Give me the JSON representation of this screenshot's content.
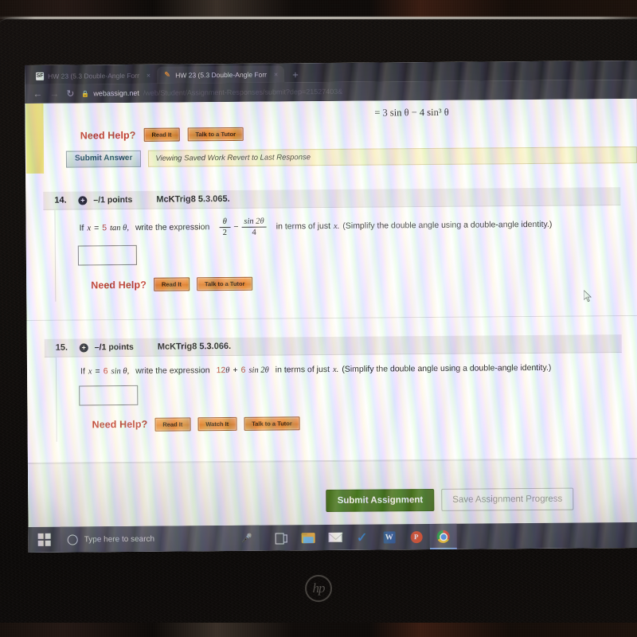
{
  "device": {
    "brand_logo": "hp"
  },
  "browser": {
    "tabs": [
      {
        "title": "HW 23 (5.3 Double-Angle Forr",
        "favicon": "sf-icon",
        "active": false,
        "close": "×"
      },
      {
        "title": "HW 23 (5.3 Double-Angle Forr",
        "favicon": "pencil-icon",
        "active": true,
        "close": "×"
      }
    ],
    "new_tab": "+",
    "nav": {
      "back": "←",
      "forward": "→",
      "reload": "↻"
    },
    "address": {
      "lock_icon": "lock-icon",
      "host": "webassign.net",
      "path": "/web/Student/Assignment-Responses/submit?dep=21527403&"
    }
  },
  "page": {
    "partial_question": {
      "equation": "= 3 sin θ − 4 sin³ θ",
      "need_help_label": "Need Help?",
      "help_buttons": [
        "Read It",
        "Talk to a Tutor"
      ],
      "submit_answer_label": "Submit Answer",
      "saved_work_note": "Viewing Saved Work Revert to Last Response"
    },
    "questions": [
      {
        "number": "14.",
        "expand_icon": "plus-circle-icon",
        "points": "–/1 points",
        "code": "McKTrig8 5.3.065.",
        "prompt_prefix": "If",
        "given_var": "x",
        "given_eq": "=",
        "given_coef": "5",
        "given_func": "tan θ,",
        "prompt_mid": "write the expression",
        "expression": {
          "type": "fraction-difference",
          "term1_num": "θ",
          "term1_den": "2",
          "operator": "−",
          "term2_num": "sin 2θ",
          "term2_den": "4"
        },
        "prompt_suffix": "in terms of just",
        "suffix_var": "x.",
        "parenthetical": "(Simplify the double angle using a double-angle identity.)",
        "answer_value": "",
        "need_help_label": "Need Help?",
        "help_buttons": [
          "Read It",
          "Talk to a Tutor"
        ]
      },
      {
        "number": "15.",
        "expand_icon": "plus-circle-icon",
        "points": "–/1 points",
        "code": "McKTrig8 5.3.066.",
        "prompt_prefix": "If",
        "given_var": "x",
        "given_eq": "=",
        "given_coef": "6",
        "given_func": "sin θ,",
        "prompt_mid": "write the expression",
        "expression": {
          "type": "inline",
          "coef1": "12",
          "sym1": "θ",
          "operator": "+",
          "coef2": "6",
          "sym2": "sin 2θ"
        },
        "prompt_suffix": "in terms of just",
        "suffix_var": "x.",
        "parenthetical": "(Simplify the double angle using a double-angle identity.)",
        "answer_value": "",
        "need_help_label": "Need Help?",
        "help_buttons": [
          "Read It",
          "Watch It",
          "Talk to a Tutor"
        ]
      }
    ],
    "actions": {
      "submit_assignment": "Submit Assignment",
      "save_progress": "Save Assignment Progress"
    }
  },
  "taskbar": {
    "start_icon": "windows-logo-icon",
    "search_placeholder": "Type here to search",
    "cortana_icon": "cortana-circle-icon",
    "mic_icon": "microphone-icon",
    "icons": [
      {
        "name": "task-view-icon"
      },
      {
        "name": "file-explorer-icon"
      },
      {
        "name": "mail-icon"
      },
      {
        "name": "check-icon"
      },
      {
        "name": "word-icon",
        "glyph": "W"
      },
      {
        "name": "powerpoint-icon",
        "glyph": "P"
      },
      {
        "name": "chrome-icon",
        "active": true
      }
    ]
  },
  "colors": {
    "accent_orange": "#e8852e",
    "submit_green": "#4a7a1e",
    "need_help_red": "#c0392b",
    "math_red": "#c0392b",
    "taskbar": "#3f3f4e",
    "chrome_tabbar": "#2b2a33",
    "yellow_highlight": "#f0e87f"
  }
}
